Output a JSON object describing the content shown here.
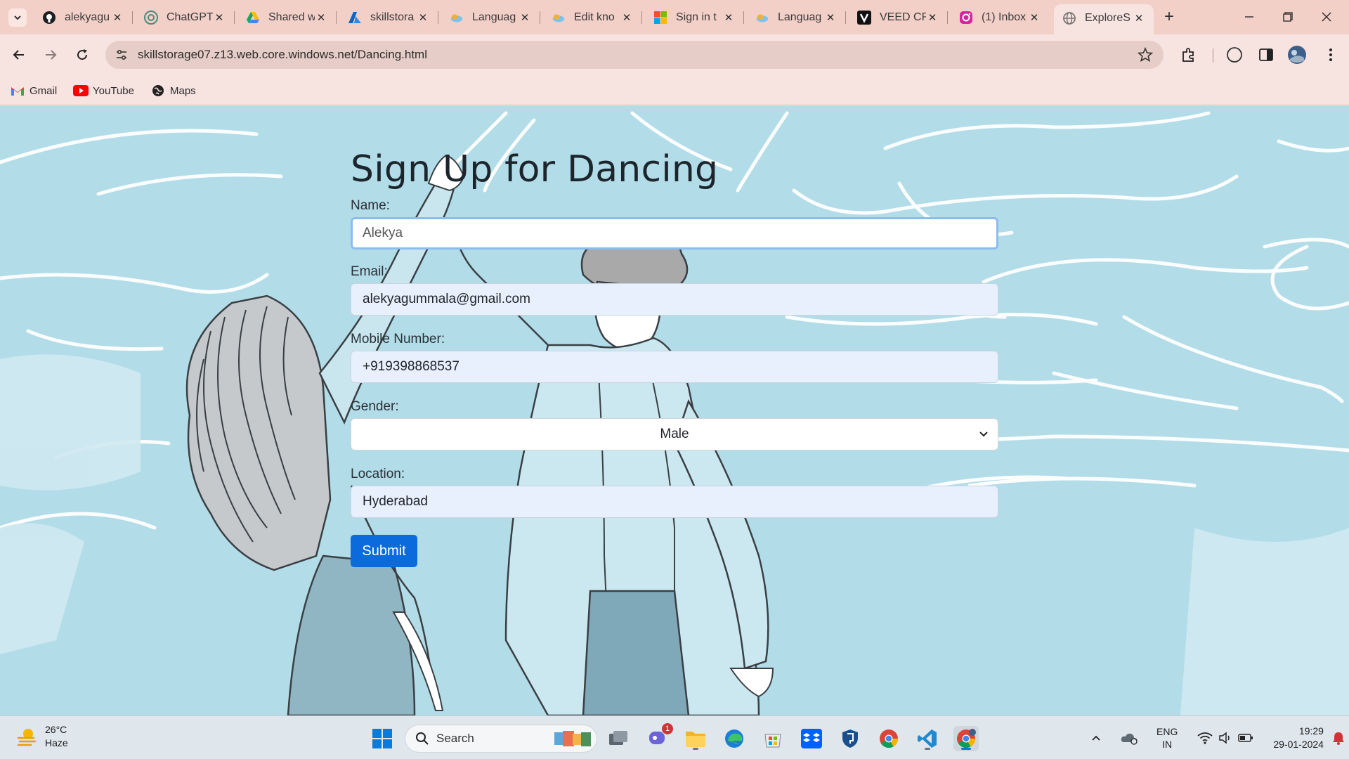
{
  "browser": {
    "tabs": [
      {
        "title": "alekyagu",
        "icon": "github-icon"
      },
      {
        "title": "ChatGPT",
        "icon": "chatgpt-icon"
      },
      {
        "title": "Shared w",
        "icon": "google-drive-icon"
      },
      {
        "title": "skillstora",
        "icon": "azure-icon"
      },
      {
        "title": "Languag",
        "icon": "cloud-icon"
      },
      {
        "title": "Edit kno",
        "icon": "cloud-icon"
      },
      {
        "title": "Sign in t",
        "icon": "microsoft-icon"
      },
      {
        "title": "Languag",
        "icon": "cloud-icon"
      },
      {
        "title": "VEED CR",
        "icon": "veed-icon"
      },
      {
        "title": "(1) Inbox",
        "icon": "instagram-icon"
      },
      {
        "title": "ExploreS",
        "icon": "globe-icon",
        "active": true
      }
    ],
    "url": "skillstorage07.z13.web.core.windows.net/Dancing.html",
    "bookmarks": [
      {
        "label": "Gmail",
        "icon": "gmail-icon"
      },
      {
        "label": "YouTube",
        "icon": "youtube-icon"
      },
      {
        "label": "Maps",
        "icon": "maps-icon"
      }
    ]
  },
  "form": {
    "title": "Sign Up for Dancing",
    "name_label": "Name:",
    "name_value": "Alekya",
    "email_label": "Email:",
    "email_value": "alekyagummala@gmail.com",
    "mobile_label": "Mobile Number:",
    "mobile_value": "+919398868537",
    "gender_label": "Gender:",
    "gender_value": "Male",
    "location_label": "Location:",
    "location_value": "Hyderabad",
    "submit_label": "Submit"
  },
  "colors": {
    "page_background": "#b2dde8",
    "submit_button": "#0b6bdc",
    "autofill_field": "#e8f0fe"
  },
  "taskbar": {
    "weather_temp": "26°C",
    "weather_desc": "Haze",
    "search_label": "Search",
    "chat_badge": "1",
    "language_line1": "ENG",
    "language_line2": "IN",
    "time": "19:29",
    "date": "29-01-2024"
  }
}
